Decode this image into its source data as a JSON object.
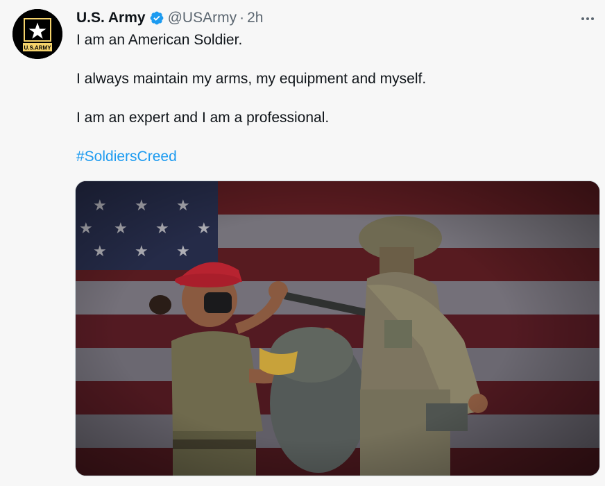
{
  "tweet": {
    "author": {
      "name": "U.S. Army",
      "handle": "@USArmy",
      "avatar_text": "U.S.ARMY"
    },
    "separator": "·",
    "time": "2h",
    "lines": [
      "I am an American Soldier.",
      "I always maintain my arms, my equipment and myself.",
      "I am an expert and I am a professional."
    ],
    "hashtag": "#SoldiersCreed",
    "colors": {
      "link": "#1d9bf0",
      "verified": "#1d9bf0",
      "secondary_text": "#5b6670",
      "background": "#f7f7f7"
    },
    "icons": {
      "verified": "verified-badge-icon",
      "more": "more-options-icon"
    }
  }
}
